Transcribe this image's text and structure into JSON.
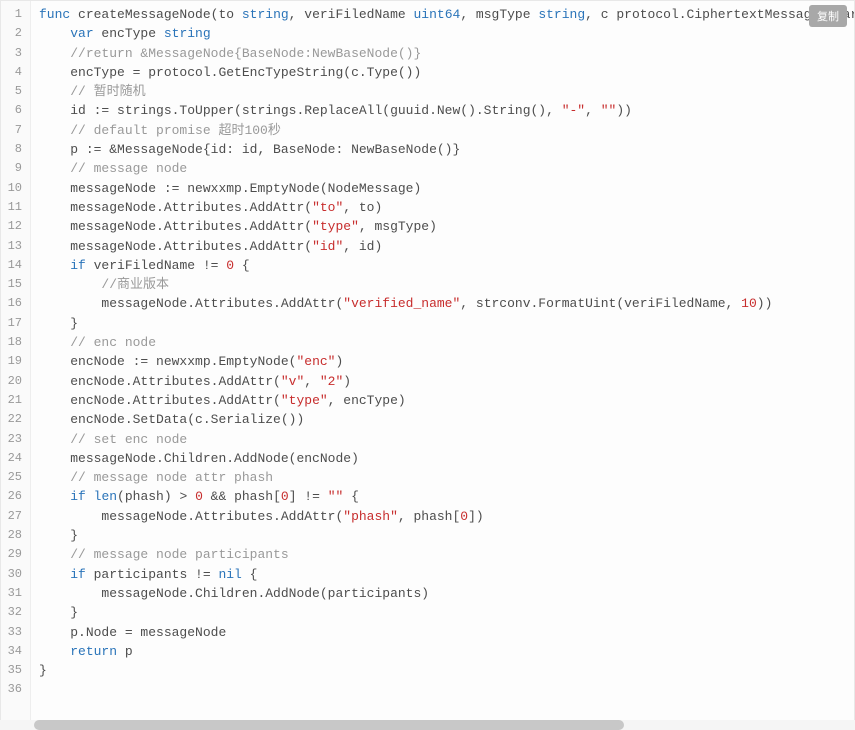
{
  "copy_label": "复制",
  "line_count": 36,
  "code_lines": [
    {
      "indent": 0,
      "spans": [
        {
          "text": "func",
          "class": "kw"
        },
        {
          "text": " createMessageNode(to ",
          "class": ""
        },
        {
          "text": "string",
          "class": "type"
        },
        {
          "text": ", veriFiledName ",
          "class": ""
        },
        {
          "text": "uint64",
          "class": "type"
        },
        {
          "text": ", msgType ",
          "class": ""
        },
        {
          "text": "string",
          "class": "type"
        },
        {
          "text": ", c protocol.CiphertextMessage, participan",
          "class": ""
        }
      ]
    },
    {
      "indent": 1,
      "spans": [
        {
          "text": "var",
          "class": "kw"
        },
        {
          "text": " encType ",
          "class": ""
        },
        {
          "text": "string",
          "class": "type"
        }
      ]
    },
    {
      "indent": 1,
      "spans": [
        {
          "text": "//return &MessageNode{BaseNode:NewBaseNode()}",
          "class": "comment"
        }
      ]
    },
    {
      "indent": 1,
      "spans": [
        {
          "text": "encType = protocol.GetEncTypeString(c.Type())",
          "class": ""
        }
      ]
    },
    {
      "indent": 1,
      "spans": [
        {
          "text": "// 暂时随机",
          "class": "comment"
        }
      ]
    },
    {
      "indent": 1,
      "spans": [
        {
          "text": "id := strings.ToUpper(strings.ReplaceAll(guuid.New().String(), ",
          "class": ""
        },
        {
          "text": "\"-\"",
          "class": "str"
        },
        {
          "text": ", ",
          "class": ""
        },
        {
          "text": "\"\"",
          "class": "str"
        },
        {
          "text": "))",
          "class": ""
        }
      ]
    },
    {
      "indent": 1,
      "spans": [
        {
          "text": "// default promise 超时100秒",
          "class": "comment"
        }
      ]
    },
    {
      "indent": 1,
      "spans": [
        {
          "text": "p := &MessageNode{id: id, BaseNode: NewBaseNode()}",
          "class": ""
        }
      ]
    },
    {
      "indent": 1,
      "spans": [
        {
          "text": "// message node",
          "class": "comment"
        }
      ]
    },
    {
      "indent": 1,
      "spans": [
        {
          "text": "messageNode := newxxmp.EmptyNode(NodeMessage)",
          "class": ""
        }
      ]
    },
    {
      "indent": 1,
      "spans": [
        {
          "text": "messageNode.Attributes.AddAttr(",
          "class": ""
        },
        {
          "text": "\"to\"",
          "class": "str"
        },
        {
          "text": ", to)",
          "class": ""
        }
      ]
    },
    {
      "indent": 1,
      "spans": [
        {
          "text": "messageNode.Attributes.AddAttr(",
          "class": ""
        },
        {
          "text": "\"type\"",
          "class": "str"
        },
        {
          "text": ", msgType)",
          "class": ""
        }
      ]
    },
    {
      "indent": 1,
      "spans": [
        {
          "text": "messageNode.Attributes.AddAttr(",
          "class": ""
        },
        {
          "text": "\"id\"",
          "class": "str"
        },
        {
          "text": ", id)",
          "class": ""
        }
      ]
    },
    {
      "indent": 1,
      "spans": [
        {
          "text": "if",
          "class": "kw"
        },
        {
          "text": " veriFiledName != ",
          "class": ""
        },
        {
          "text": "0",
          "class": "num"
        },
        {
          "text": " {",
          "class": ""
        }
      ]
    },
    {
      "indent": 2,
      "spans": [
        {
          "text": "//商业版本",
          "class": "comment"
        }
      ]
    },
    {
      "indent": 2,
      "spans": [
        {
          "text": "messageNode.Attributes.AddAttr(",
          "class": ""
        },
        {
          "text": "\"verified_name\"",
          "class": "str"
        },
        {
          "text": ", strconv.FormatUint(veriFiledName, ",
          "class": ""
        },
        {
          "text": "10",
          "class": "num"
        },
        {
          "text": "))",
          "class": ""
        }
      ]
    },
    {
      "indent": 1,
      "spans": [
        {
          "text": "}",
          "class": ""
        }
      ]
    },
    {
      "indent": 1,
      "spans": [
        {
          "text": "// enc node",
          "class": "comment"
        }
      ]
    },
    {
      "indent": 1,
      "spans": [
        {
          "text": "encNode := newxxmp.EmptyNode(",
          "class": ""
        },
        {
          "text": "\"enc\"",
          "class": "str"
        },
        {
          "text": ")",
          "class": ""
        }
      ]
    },
    {
      "indent": 1,
      "spans": [
        {
          "text": "encNode.Attributes.AddAttr(",
          "class": ""
        },
        {
          "text": "\"v\"",
          "class": "str"
        },
        {
          "text": ", ",
          "class": ""
        },
        {
          "text": "\"2\"",
          "class": "str"
        },
        {
          "text": ")",
          "class": ""
        }
      ]
    },
    {
      "indent": 1,
      "spans": [
        {
          "text": "encNode.Attributes.AddAttr(",
          "class": ""
        },
        {
          "text": "\"type\"",
          "class": "str"
        },
        {
          "text": ", encType)",
          "class": ""
        }
      ]
    },
    {
      "indent": 1,
      "spans": [
        {
          "text": "encNode.SetData(c.Serialize())",
          "class": ""
        }
      ]
    },
    {
      "indent": 1,
      "spans": [
        {
          "text": "// set enc node",
          "class": "comment"
        }
      ]
    },
    {
      "indent": 1,
      "spans": [
        {
          "text": "messageNode.Children.AddNode(encNode)",
          "class": ""
        }
      ]
    },
    {
      "indent": 1,
      "spans": [
        {
          "text": "// message node attr phash",
          "class": "comment"
        }
      ]
    },
    {
      "indent": 1,
      "spans": [
        {
          "text": "if",
          "class": "kw"
        },
        {
          "text": " ",
          "class": ""
        },
        {
          "text": "len",
          "class": "kw"
        },
        {
          "text": "(phash) > ",
          "class": ""
        },
        {
          "text": "0",
          "class": "num"
        },
        {
          "text": " && phash[",
          "class": ""
        },
        {
          "text": "0",
          "class": "num"
        },
        {
          "text": "] != ",
          "class": ""
        },
        {
          "text": "\"\"",
          "class": "str"
        },
        {
          "text": " {",
          "class": ""
        }
      ]
    },
    {
      "indent": 2,
      "spans": [
        {
          "text": "messageNode.Attributes.AddAttr(",
          "class": ""
        },
        {
          "text": "\"phash\"",
          "class": "str"
        },
        {
          "text": ", phash[",
          "class": ""
        },
        {
          "text": "0",
          "class": "num"
        },
        {
          "text": "])",
          "class": ""
        }
      ]
    },
    {
      "indent": 1,
      "spans": [
        {
          "text": "}",
          "class": ""
        }
      ]
    },
    {
      "indent": 1,
      "spans": [
        {
          "text": "// message node participants",
          "class": "comment"
        }
      ]
    },
    {
      "indent": 1,
      "spans": [
        {
          "text": "if",
          "class": "kw"
        },
        {
          "text": " participants != ",
          "class": ""
        },
        {
          "text": "nil",
          "class": "kw"
        },
        {
          "text": " {",
          "class": ""
        }
      ]
    },
    {
      "indent": 2,
      "spans": [
        {
          "text": "messageNode.Children.AddNode(participants)",
          "class": ""
        }
      ]
    },
    {
      "indent": 1,
      "spans": [
        {
          "text": "}",
          "class": ""
        }
      ]
    },
    {
      "indent": 0,
      "spans": [
        {
          "text": "",
          "class": ""
        }
      ]
    },
    {
      "indent": 1,
      "spans": [
        {
          "text": "p.Node = messageNode",
          "class": ""
        }
      ]
    },
    {
      "indent": 1,
      "spans": [
        {
          "text": "return",
          "class": "kw"
        },
        {
          "text": " p",
          "class": ""
        }
      ]
    },
    {
      "indent": 0,
      "spans": [
        {
          "text": "}",
          "class": ""
        }
      ]
    }
  ]
}
